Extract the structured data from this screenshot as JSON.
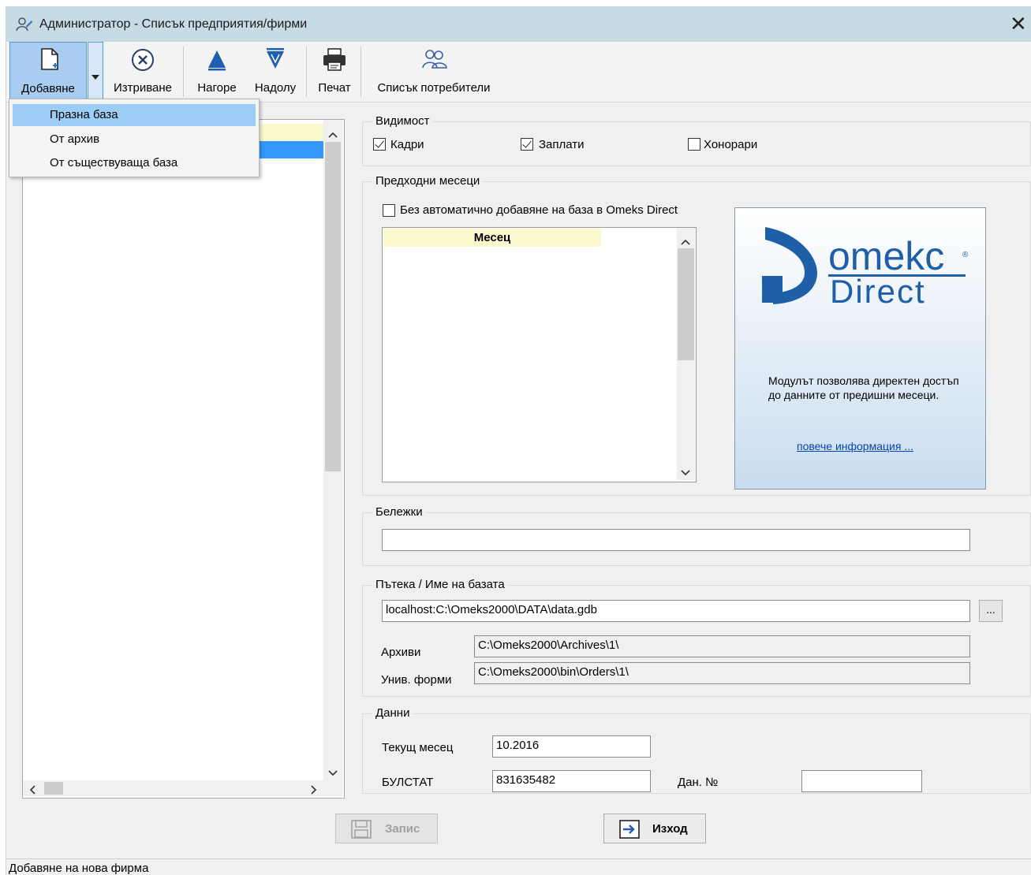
{
  "window": {
    "title": "Администратор - Списък предприятия/фирми"
  },
  "toolbar": {
    "add": "Добавяне",
    "delete": "Изтриване",
    "up": "Нагоре",
    "down": "Надолу",
    "print": "Печат",
    "users": "Списък потребители"
  },
  "add_menu": {
    "items": [
      "Празна база",
      "От архив",
      "От съществуваща база"
    ],
    "selected_index": 0
  },
  "visibility": {
    "legend": "Видимост",
    "kadri": {
      "label": "Кадри",
      "checked": true
    },
    "zaplati": {
      "label": "Заплати",
      "checked": true
    },
    "honorari": {
      "label": "Хонорари",
      "checked": false
    }
  },
  "prev_months": {
    "legend": "Предходни месеци",
    "no_auto_label": "Без автоматично добавяне на база в Omeks Direct",
    "column_header": "Месец"
  },
  "promo": {
    "logo_text": "omekc Direct",
    "description": "Модулът позволява директен достъп до данните от предишни месеци.",
    "link": "повече информация ..."
  },
  "notes": {
    "legend": "Бележки",
    "value": ""
  },
  "path": {
    "legend": "Пътека / Име на базата",
    "db_value": "localhost:C:\\Omeks2000\\DATA\\data.gdb",
    "browse_label": "...",
    "archives_label": "Архиви",
    "archives_value": "C:\\Omeks2000\\Archives\\1\\",
    "forms_label": "Унив. форми",
    "forms_value": "C:\\Omeks2000\\bin\\Orders\\1\\"
  },
  "data": {
    "legend": "Данни",
    "current_month_label": "Текущ месец",
    "current_month_value": "10.2016",
    "bulstat_label": "БУЛСТАТ",
    "bulstat_value": "831635482",
    "tax_no_label": "Дан. №",
    "tax_no_value": ""
  },
  "buttons": {
    "save": "Запис",
    "exit": "Изход"
  },
  "status": "Добавяне на нова фирма",
  "colors": {
    "title_bar": "#c6dbe3",
    "menu_selected": "#9dcdf6",
    "highlight_yellow": "#fdf9cf",
    "list_selected": "#3399ff",
    "link": "#0645ad"
  }
}
